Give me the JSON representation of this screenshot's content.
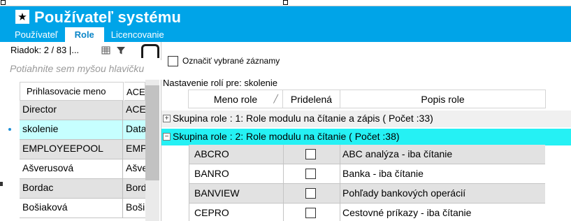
{
  "window": {
    "title": "Používateľ systému",
    "star_icon": "star-icon"
  },
  "tabs": [
    {
      "label": "Používateľ",
      "active": false
    },
    {
      "label": "Role",
      "active": true
    },
    {
      "label": "Licencovanie",
      "active": false
    }
  ],
  "left": {
    "record_counter": "Riadok: 2 / 83 |...",
    "drag_hint": "Potiahnite sem myšou hlavičku",
    "columns": [
      "Prihlasovacie meno",
      "ACE"
    ],
    "rows": [
      {
        "login": "Director",
        "col2": "ACE",
        "style": "gray"
      },
      {
        "login": "skolenie",
        "col2": "Data",
        "style": "sel"
      },
      {
        "login": "EMPLOYEEPOOL",
        "col2": "EMP",
        "style": "gray"
      },
      {
        "login": "Ašverusová",
        "col2": "Ašve",
        "style": "white"
      },
      {
        "login": "Bordac",
        "col2": "Bord",
        "style": "gray"
      },
      {
        "login": "Bošiaková",
        "col2": "Boši",
        "style": "white"
      }
    ]
  },
  "right": {
    "select_label": "Označiť vybrané záznamy",
    "settings_label": "Nastavenie rolí pre: skolenie",
    "columns": {
      "name": "Meno role",
      "assigned": "Pridelená",
      "desc": "Popis role"
    },
    "groups": [
      {
        "label": "Skupina role : 1: Role modulu na čítanie a zápis ( Počet :33)",
        "expanded": false,
        "sign": "+"
      },
      {
        "label": "Skupina role : 2: Role modulu na čítanie ( Počet :38)",
        "expanded": true,
        "sign": "−"
      }
    ],
    "roles": [
      {
        "name": "ABCRO",
        "assigned": false,
        "desc": "ABC analýza - iba čítanie",
        "style": "gray"
      },
      {
        "name": "BANRO",
        "assigned": false,
        "desc": "Banka - iba čítanie",
        "style": "white"
      },
      {
        "name": "BANVIEW",
        "assigned": false,
        "desc": "Pohľady bankových operácií",
        "style": "gray"
      },
      {
        "name": "CEPRO",
        "assigned": false,
        "desc": "Cestovné príkazy - iba čítanie",
        "style": "white"
      }
    ]
  }
}
